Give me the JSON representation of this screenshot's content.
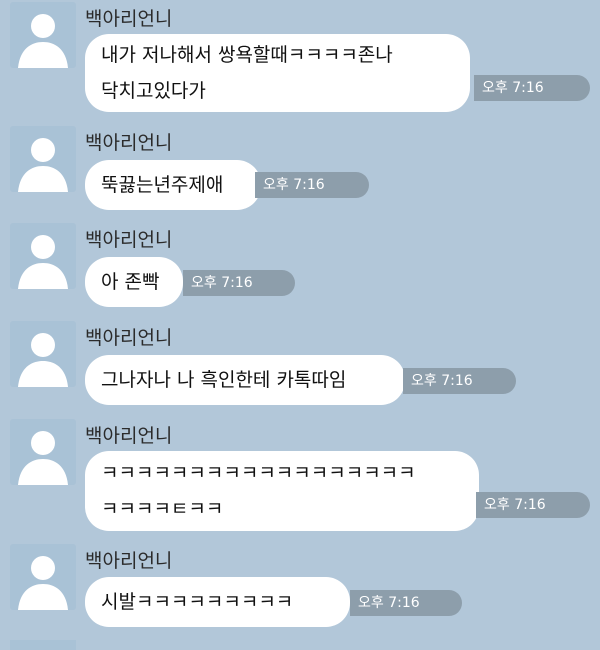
{
  "messages": [
    {
      "sender": "백아리언니",
      "lines": [
        "내가 저나해서 쌍욕할때ㅋㅋㅋㅋ존나",
        "닥치고있다가"
      ],
      "time": "오후 7:16"
    },
    {
      "sender": "백아리언니",
      "lines": [
        "뚝끓는년주제애"
      ],
      "time": "오후 7:16"
    },
    {
      "sender": "백아리언니",
      "lines": [
        "아 존빡"
      ],
      "time": "오후 7:16"
    },
    {
      "sender": "백아리언니",
      "lines": [
        "그나자나 나 흑인한테 카톡따임"
      ],
      "time": "오후 7:16"
    },
    {
      "sender": "백아리언니",
      "lines": [
        "ㅋㅋㅋㅋㅋㅋㅋㅋㅋㅋㅋㅋㅋㅋㅋㅋㅋㅋ",
        "ㅋㅋㅋㅋㅌㅋㅋ"
      ],
      "time": "오후 7:16"
    },
    {
      "sender": "백아리언니",
      "lines": [
        "시발ㅋㅋㅋㅋㅋㅋㅋㅋㅋ"
      ],
      "time": "오후 7:16"
    }
  ],
  "colors": {
    "background": "#b2c7d9",
    "bubble": "#ffffff",
    "time_badge": "#8d9eab",
    "avatar": "#a9c2d6"
  }
}
